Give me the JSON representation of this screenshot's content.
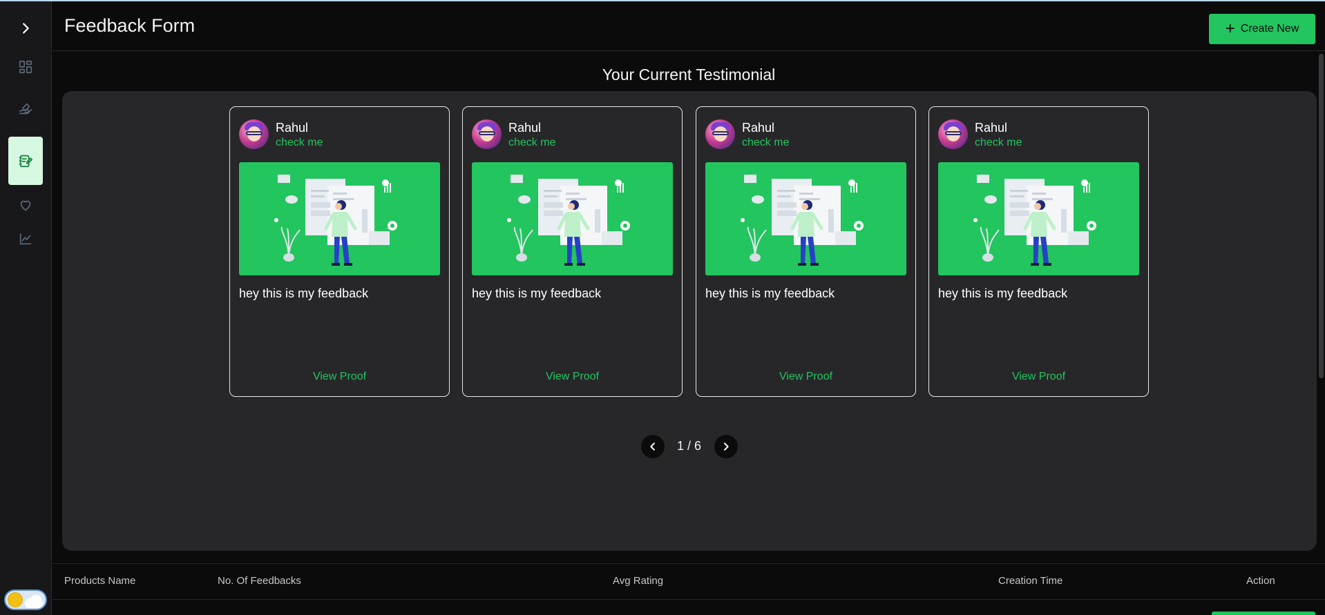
{
  "header": {
    "title": "Feedback Form",
    "create_label": "Create New"
  },
  "sidebar": {
    "items": [
      {
        "name": "expand",
        "icon": "chevron-right-icon"
      },
      {
        "name": "dashboard",
        "icon": "grid-icon"
      },
      {
        "name": "integrations",
        "icon": "hand-pen-icon"
      },
      {
        "name": "feedback-forms",
        "icon": "edit-note-icon",
        "active": true
      },
      {
        "name": "favorites",
        "icon": "heart-icon"
      },
      {
        "name": "analytics",
        "icon": "chart-line-icon"
      }
    ],
    "theme_toggle": "light"
  },
  "testimonials": {
    "section_title": "Your Current Testimonial",
    "cards": [
      {
        "name": "Rahul",
        "tag": "check me",
        "feedback": "hey this is my feedback",
        "proof_label": "View Proof"
      },
      {
        "name": "Rahul",
        "tag": "check me",
        "feedback": "hey this is my feedback",
        "proof_label": "View Proof"
      },
      {
        "name": "Rahul",
        "tag": "check me",
        "feedback": "hey this is my feedback",
        "proof_label": "View Proof"
      },
      {
        "name": "Rahul",
        "tag": "check me",
        "feedback": "hey this is my feedback",
        "proof_label": "View Proof"
      }
    ],
    "pagination": "1 / 6"
  },
  "table": {
    "columns": [
      "Products Name",
      "No. Of Feedbacks",
      "Avg Rating",
      "Creation Time",
      "Action"
    ]
  },
  "colors": {
    "accent": "#22c55e",
    "background": "#0b0b0b",
    "panel": "#27272a",
    "sidebar": "#18181b"
  }
}
